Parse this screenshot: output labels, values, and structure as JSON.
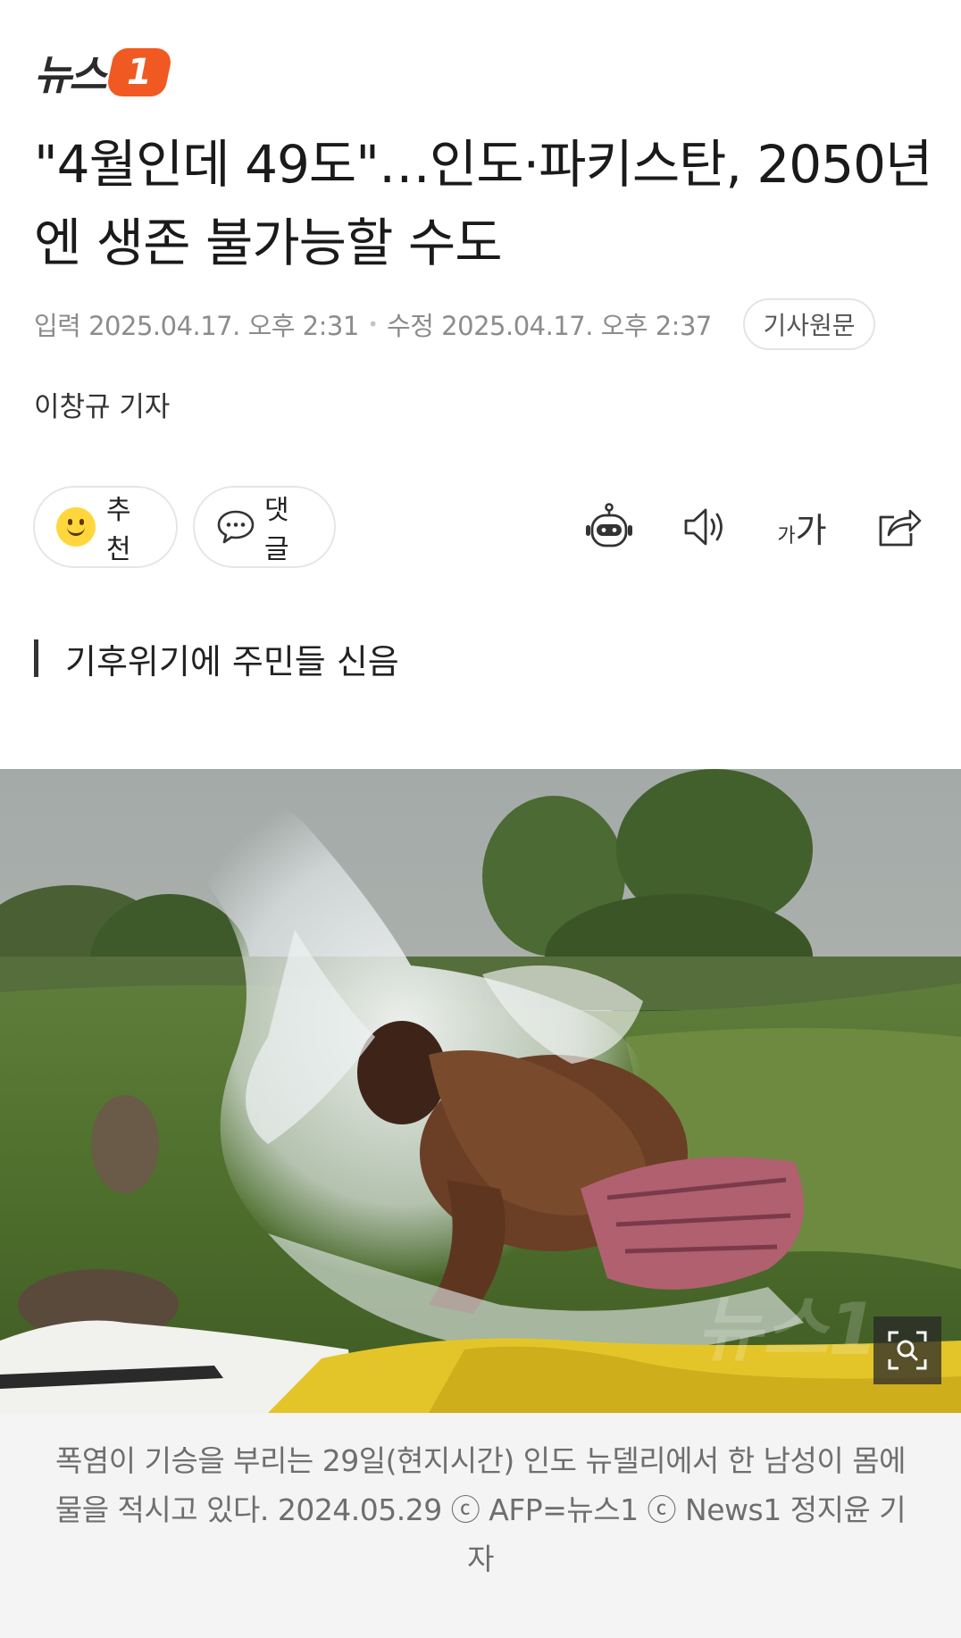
{
  "logo": {
    "text": "뉴스",
    "badge": "1"
  },
  "article": {
    "headline": "\"4월인데 49도\"…인도·파키스탄, 2050년엔 생존 불가능할 수도",
    "input_label": "입력",
    "input_time": "2025.04.17. 오후 2:31",
    "modified_label": "수정",
    "modified_time": "2025.04.17. 오후 2:37",
    "original_button": "기사원문",
    "byline": "이창규 기자",
    "subheading": "기후위기에 주민들 신음"
  },
  "actions": {
    "recommend_label": "추천",
    "comment_label": "댓글"
  },
  "toolbar": {
    "font_small": "가",
    "font_large": "가"
  },
  "photo": {
    "caption": "폭염이 기승을 부리는 29일(현지시간) 인도 뉴델리에서 한 남성이 몸에 물을 적시고 있다. 2024.05.29 ⓒ AFP=뉴스1 ⓒ News1 정지윤 기자"
  },
  "colors": {
    "brand": "#f05a22",
    "caption_bg": "#f4f4f4"
  },
  "icons": [
    "smile-icon",
    "chat-bubble-icon",
    "robot-icon",
    "speaker-icon",
    "font-size-icon",
    "share-icon",
    "zoom-icon"
  ]
}
